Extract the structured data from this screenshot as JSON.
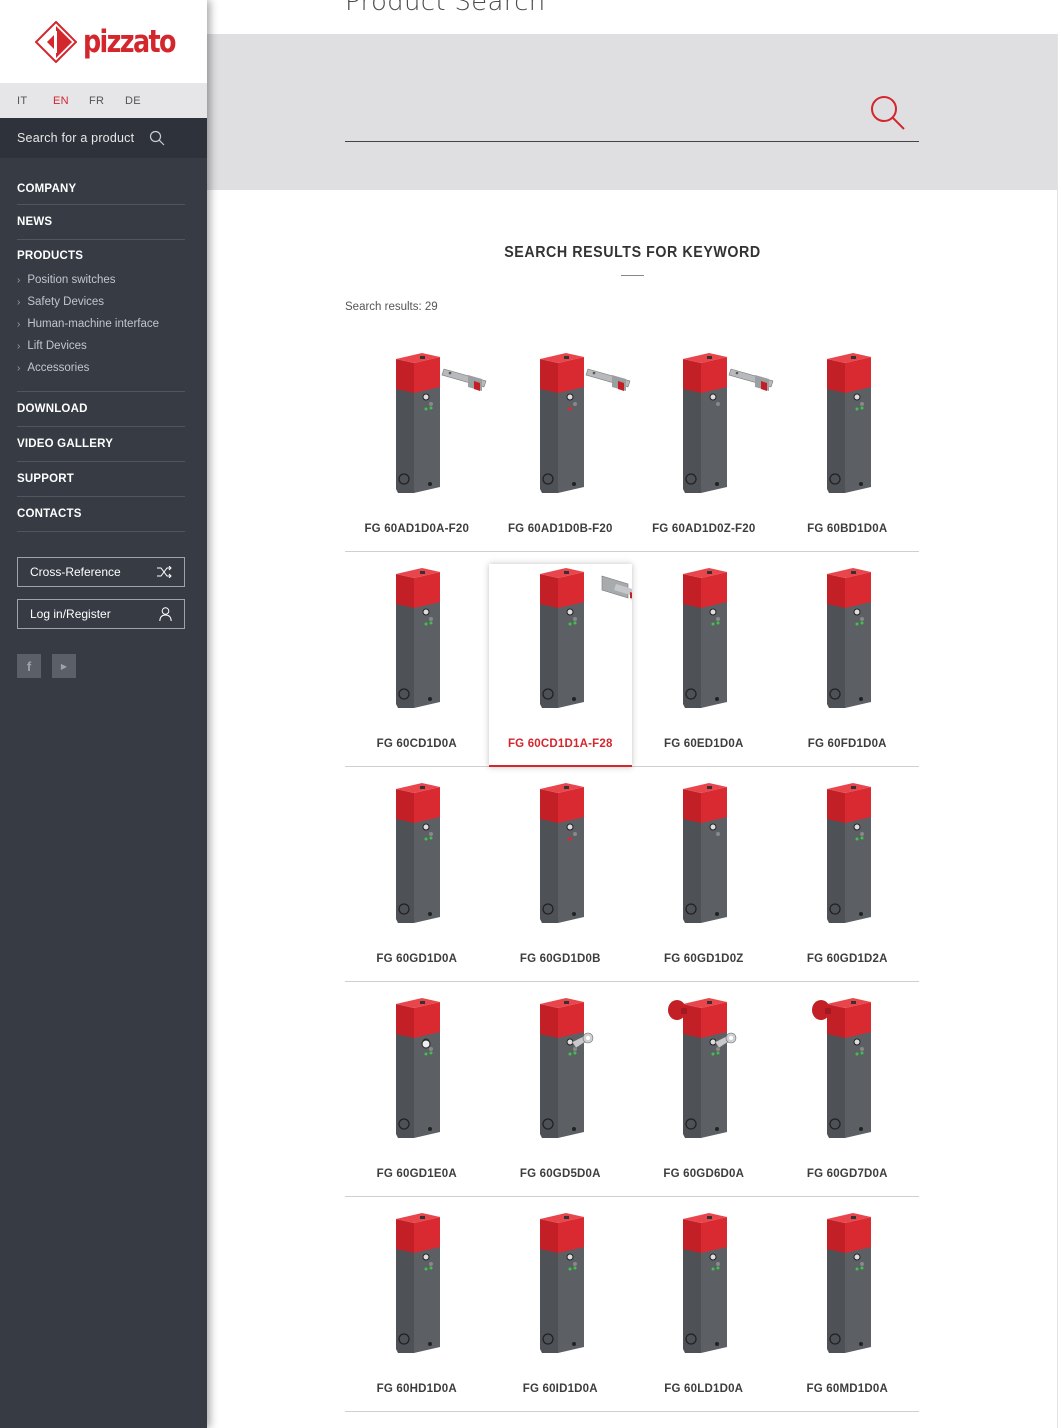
{
  "brand": {
    "name": "pizzato",
    "color": "#d3262d"
  },
  "languages": [
    {
      "code": "IT",
      "active": false
    },
    {
      "code": "EN",
      "active": true
    },
    {
      "code": "FR",
      "active": false
    },
    {
      "code": "DE",
      "active": false
    }
  ],
  "sidebar_search": {
    "placeholder": "Search for a product",
    "icon": "search-icon"
  },
  "menu": {
    "company": "COMPANY",
    "news": "NEWS",
    "products": "PRODUCTS",
    "products_sub": [
      "Position switches",
      "Safety Devices",
      "Human-machine interface",
      "Lift Devices",
      "Accessories"
    ],
    "download": "DOWNLOAD",
    "video_gallery": "VIDEO GALLERY",
    "support": "SUPPORT",
    "contacts": "CONTACTS"
  },
  "buttons": {
    "cross_reference": "Cross-Reference",
    "cross_reference_icon": "shuffle-icon",
    "login": "Log in/Register",
    "login_icon": "user-icon"
  },
  "social": [
    "facebook-icon",
    "youtube-icon"
  ],
  "page": {
    "title": "Product Search",
    "search_value": "",
    "heading_prefix": "SEARCH RESULTS FOR ",
    "heading_keyword": "KEYWORD",
    "results_count": "Search results: 29"
  },
  "products": [
    {
      "name": "FG 60AD1D0A-F20",
      "variant": "actuator-straight",
      "led": "green"
    },
    {
      "name": "FG 60AD1D0B-F20",
      "variant": "actuator-straight",
      "led": "red"
    },
    {
      "name": "FG 60AD1D0Z-F20",
      "variant": "actuator-straight",
      "led": "none"
    },
    {
      "name": "FG 60BD1D0A",
      "variant": "plain",
      "led": "green"
    },
    {
      "name": "FG 60CD1D0A",
      "variant": "plain",
      "led": "green"
    },
    {
      "name": "FG 60CD1D1A-F28",
      "variant": "actuator-short",
      "led": "green",
      "highlighted": true
    },
    {
      "name": "FG 60ED1D0A",
      "variant": "plain",
      "led": "green"
    },
    {
      "name": "FG 60FD1D0A",
      "variant": "plain",
      "led": "green"
    },
    {
      "name": "FG 60GD1D0A",
      "variant": "plain",
      "led": "green"
    },
    {
      "name": "FG 60GD1D0B",
      "variant": "plain",
      "led": "red"
    },
    {
      "name": "FG 60GD1D0Z",
      "variant": "plain",
      "led": "none"
    },
    {
      "name": "FG 60GD1D2A",
      "variant": "plain",
      "led": "green"
    },
    {
      "name": "FG 60GD1E0A",
      "variant": "button",
      "led": "green"
    },
    {
      "name": "FG 60GD5D0A",
      "variant": "key",
      "led": "green"
    },
    {
      "name": "FG 60GD6D0A",
      "variant": "key-mushroom",
      "led": "green"
    },
    {
      "name": "FG 60GD7D0A",
      "variant": "mushroom",
      "led": "green"
    },
    {
      "name": "FG 60HD1D0A",
      "variant": "plain",
      "led": "green"
    },
    {
      "name": "FG 60ID1D0A",
      "variant": "plain",
      "led": "green"
    },
    {
      "name": "FG 60LD1D0A",
      "variant": "plain",
      "led": "green"
    },
    {
      "name": "FG 60MD1D0A",
      "variant": "plain",
      "led": "green"
    }
  ]
}
